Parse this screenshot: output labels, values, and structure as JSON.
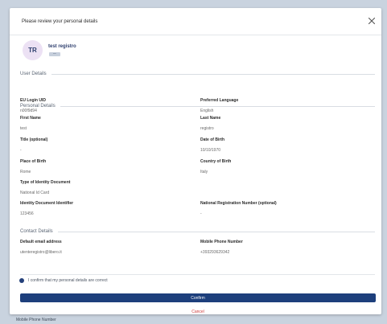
{
  "backdrop": {
    "label": "Mobile Phone Number"
  },
  "modal": {
    "title": "Please review your personal details",
    "close_icon": "close-icon"
  },
  "user": {
    "initials": "TR",
    "name": "test registro",
    "badge": "user"
  },
  "sections": {
    "user_details": "User Details",
    "personal_details": "Personal Details",
    "contact_details": "Contact Details"
  },
  "fields": {
    "eu_login_uid": {
      "label": "EU Login UID",
      "value": "n00f9d94"
    },
    "preferred_language": {
      "label": "Preferred Language",
      "value": "English"
    },
    "first_name": {
      "label": "First Name",
      "value": "test"
    },
    "last_name": {
      "label": "Last Name",
      "value": "registro"
    },
    "title": {
      "label": "Title (optional)",
      "value": "-"
    },
    "date_of_birth": {
      "label": "Date of Birth",
      "value": "10/10/1970"
    },
    "place_of_birth": {
      "label": "Place of Birth",
      "value": "Rome"
    },
    "country_of_birth": {
      "label": "Country of Birth",
      "value": "Italy"
    },
    "id_doc_type": {
      "label": "Type of Identity Document",
      "value": "National Id Card"
    },
    "id_doc_identifier": {
      "label": "Identity Document Identifier",
      "value": "123456"
    },
    "national_reg_number": {
      "label": "National Registration Number (optional)",
      "value": "-"
    },
    "email": {
      "label": "Default email address",
      "value": "utenteregistro@libero.it"
    },
    "mobile": {
      "label": "Mobile Phone Number",
      "value": "+393293629342"
    }
  },
  "confirm_check": {
    "label": "I confirm that my personal details are correct",
    "checked": true
  },
  "actions": {
    "confirm": "Confirm",
    "cancel": "Cancel"
  },
  "colors": {
    "primary": "#1d3f7c",
    "cancel": "#cf3a3a",
    "avatar_bg": "#ece1f4"
  }
}
